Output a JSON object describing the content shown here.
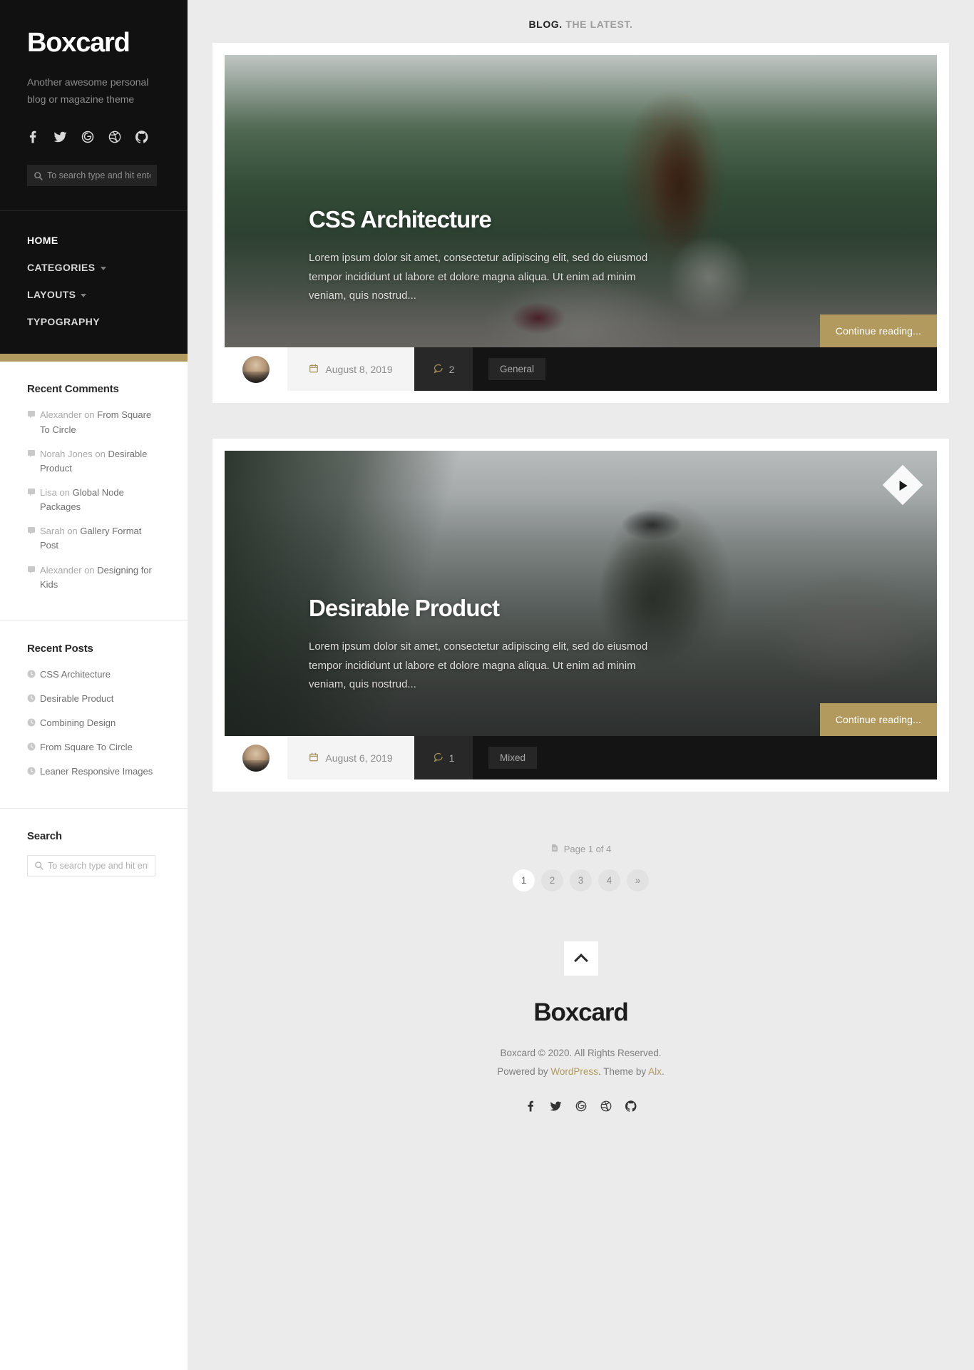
{
  "sidebar": {
    "brand": {
      "title": "Boxcard",
      "description": "Another awesome personal blog or magazine theme"
    },
    "social": [
      {
        "name": "facebook-icon",
        "label": "Facebook"
      },
      {
        "name": "twitter-icon",
        "label": "Twitter"
      },
      {
        "name": "google-icon",
        "label": "Google"
      },
      {
        "name": "dribbble-icon",
        "label": "Dribbble"
      },
      {
        "name": "github-icon",
        "label": "GitHub"
      }
    ],
    "search": {
      "placeholder": "To search type and hit enter",
      "value": ""
    },
    "nav": [
      {
        "label": "HOME",
        "active": true,
        "has_caret": false
      },
      {
        "label": "CATEGORIES",
        "active": false,
        "has_caret": true
      },
      {
        "label": "LAYOUTS",
        "active": false,
        "has_caret": true
      },
      {
        "label": "TYPOGRAPHY",
        "active": false,
        "has_caret": false
      }
    ],
    "accent_color": "#b29a5e",
    "widgets": {
      "recent_comments": {
        "title": "Recent Comments",
        "items": [
          {
            "author": "Alexander",
            "on": "on",
            "post": "From Square To Circle"
          },
          {
            "author": "Norah Jones",
            "on": "on",
            "post": "Desirable Product"
          },
          {
            "author": "Lisa",
            "on": "on",
            "post": "Global Node Packages"
          },
          {
            "author": "Sarah",
            "on": "on",
            "post": "Gallery Format Post"
          },
          {
            "author": "Alexander",
            "on": "on",
            "post": "Designing for Kids"
          }
        ]
      },
      "recent_posts": {
        "title": "Recent Posts",
        "items": [
          "CSS Architecture",
          "Desirable Product",
          "Combining Design",
          "From Square To Circle",
          "Leaner Responsive Images"
        ]
      },
      "search": {
        "title": "Search",
        "placeholder": "To search type and hit enter",
        "value": ""
      }
    }
  },
  "main": {
    "header": {
      "primary": "BLOG.",
      "secondary": "THE LATEST."
    },
    "posts": [
      {
        "title": "CSS Architecture",
        "excerpt": "Lorem ipsum dolor sit amet, consectetur adipiscing elit, sed do eiusmod tempor incididunt ut labore et dolore magna aliqua. Ut enim ad minim veniam, quis nostrud...",
        "continue_label": "Continue reading...",
        "date": "August 8, 2019",
        "comments": "2",
        "categories": [
          "General"
        ],
        "has_play_button": false
      },
      {
        "title": "Desirable Product",
        "excerpt": "Lorem ipsum dolor sit amet, consectetur adipiscing elit, sed do eiusmod tempor incididunt ut labore et dolore magna aliqua. Ut enim ad minim veniam, quis nostrud...",
        "continue_label": "Continue reading...",
        "date": "August 6, 2019",
        "comments": "1",
        "categories": [
          "Mixed"
        ],
        "has_play_button": true
      }
    ],
    "pagination": {
      "page_of": "Page 1 of 4",
      "pages": [
        "1",
        "2",
        "3",
        "4",
        "»"
      ],
      "current_index": 0
    },
    "footer": {
      "brand": "Boxcard",
      "copyright": "Boxcard © 2020. All Rights Reserved.",
      "powered_prefix": "Powered by ",
      "powered_link": "WordPress",
      "powered_middle": ". Theme by ",
      "theme_link": "Alx",
      "powered_suffix": ".",
      "social": [
        {
          "name": "facebook-icon",
          "label": "Facebook"
        },
        {
          "name": "twitter-icon",
          "label": "Twitter"
        },
        {
          "name": "google-icon",
          "label": "Google"
        },
        {
          "name": "dribbble-icon",
          "label": "Dribbble"
        },
        {
          "name": "github-icon",
          "label": "GitHub"
        }
      ]
    }
  }
}
